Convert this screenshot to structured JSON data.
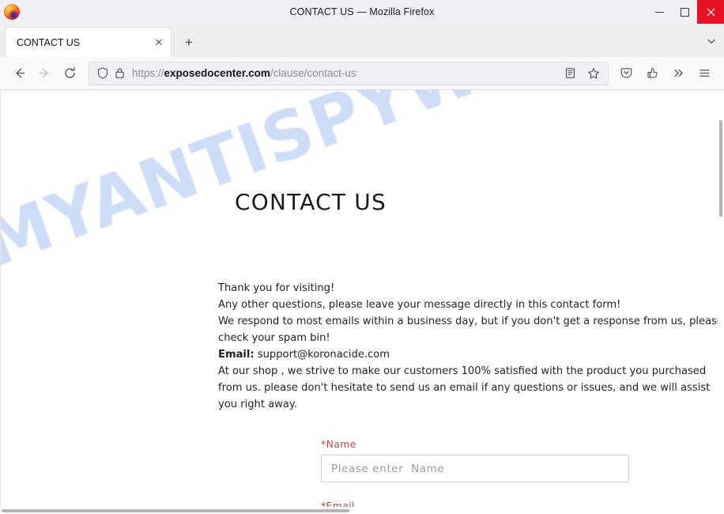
{
  "window": {
    "title": "CONTACT US — Mozilla Firefox",
    "app_icon": "firefox-logo",
    "controls": {
      "minimize": "minimize-icon",
      "maximize": "maximize-icon",
      "close": "close-icon"
    },
    "close_button_color": "#e81123"
  },
  "tabs": {
    "items": [
      {
        "label": "CONTACT US",
        "close_label": "✕",
        "active": true
      }
    ],
    "new_tab_label": "+",
    "list_all_tabs": "chevron-down-icon"
  },
  "toolbar": {
    "back": "back-arrow-icon",
    "forward": "forward-arrow-icon",
    "reload": "reload-icon",
    "shield": "shield-icon",
    "lock": "padlock-icon",
    "url": {
      "scheme": "https://",
      "host": "exposedocenter.com",
      "path": "/clause/contact-us",
      "full": "https://exposedocenter.com/clause/contact-us"
    },
    "reader_view": "reader-view-icon",
    "bookmark": "star-icon",
    "pocket": "pocket-icon",
    "extensions": "extensions-icon",
    "overflow": "double-chevron-icon",
    "app_menu": "hamburger-menu-icon"
  },
  "page": {
    "watermark": "MYANTISPYWARE.COM",
    "watermark_color": "#ccdcf7",
    "title": "CONTACT US",
    "paragraphs": [
      {
        "text": "Thank you for visiting!"
      },
      {
        "text": "Any other questions, please leave your message directly in this contact form!"
      },
      {
        "text": "We respond to most emails within a business day, but if you don't get a response from us, please check your spam bin!"
      }
    ],
    "email_line": {
      "label": "Email:",
      "address": "support@koronacide.com"
    },
    "closing_paragraph": "At our shop , we strive to make our customers 100% satisfied with the product you purchased from us. please don't hesitate to send us an email if any questions or issues, and we will assist you right away.",
    "form": {
      "name_field": {
        "required_marker": "*",
        "label": "Name",
        "placeholder": "Please enter  Name",
        "value": ""
      },
      "email_field": {
        "required_marker": "*",
        "label": "Email"
      },
      "required_color": "#b5484f"
    }
  }
}
